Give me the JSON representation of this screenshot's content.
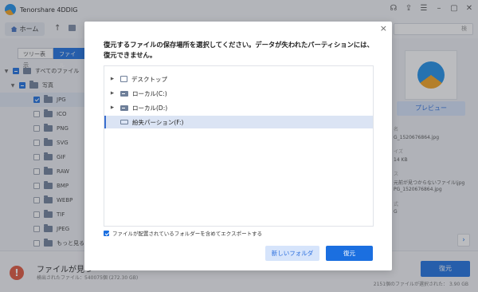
{
  "app": {
    "title": "Tenorshare 4DDIG"
  },
  "toolbar": {
    "home_label": "ホーム",
    "search_placeholder": "検"
  },
  "sidebar": {
    "tabs": [
      "ツリー表示",
      "ファイル"
    ],
    "items": [
      {
        "label": "すべてのファイル",
        "level": 0,
        "state": "partial",
        "expanded": true
      },
      {
        "label": "写真",
        "level": 1,
        "state": "partial",
        "expanded": true
      },
      {
        "label": "JPG",
        "level": 2,
        "state": "on",
        "selected": true
      },
      {
        "label": "ICO",
        "level": 2,
        "state": "off"
      },
      {
        "label": "PNG",
        "level": 2,
        "state": "off"
      },
      {
        "label": "SVG",
        "level": 2,
        "state": "off"
      },
      {
        "label": "GIF",
        "level": 2,
        "state": "off"
      },
      {
        "label": "RAW",
        "level": 2,
        "state": "off"
      },
      {
        "label": "BMP",
        "level": 2,
        "state": "off"
      },
      {
        "label": "WEBP",
        "level": 2,
        "state": "off"
      },
      {
        "label": "TIF",
        "level": 2,
        "state": "off"
      },
      {
        "label": "JPEG",
        "level": 2,
        "state": "off"
      },
      {
        "label": "もっと見る",
        "level": 2,
        "state": "off"
      }
    ]
  },
  "preview": {
    "button_label": "プレビュー",
    "details": [
      "名",
      "G_1520676864.jpg",
      "イズ",
      "14 KB",
      "ス",
      "元前が見つからないファイル\\jpg",
      "PG_1520676864.jpg",
      "式",
      "G"
    ]
  },
  "footer": {
    "title": "ファイルが見つ",
    "subtitle": "検出されたファイル：540075個 (272.30 GB)",
    "recover_label": "復元",
    "selected_info": "2151個のファイルが選択された： 3.90 GB"
  },
  "modal": {
    "close_glyph": "×",
    "message": "復元するファイルの保存場所を選択してください。データが失われたパーティションには、復元できません。",
    "locations": [
      {
        "label": "デスクトップ",
        "icon": "desktop-icon",
        "has_arrow": true,
        "selected": false
      },
      {
        "label": "ローカル(C:)",
        "icon": "drive-icon",
        "has_arrow": true,
        "selected": false
      },
      {
        "label": "ローカル(D:)",
        "icon": "drive-icon",
        "has_arrow": true,
        "selected": false
      },
      {
        "label": "紛失パーション(F:)",
        "icon": "usb-drive-icon",
        "has_arrow": false,
        "selected": true
      }
    ],
    "export_option_label": "ファイルが配置されているフォルダーを含めてエクスポートする",
    "export_option_checked": true,
    "new_folder_label": "新しいフォルダ",
    "restore_label": "復元"
  },
  "colors": {
    "accent": "#1b6fe0",
    "accent_light": "#d6e4fb",
    "selection": "#dbe4f4",
    "warning": "#e0533a"
  }
}
